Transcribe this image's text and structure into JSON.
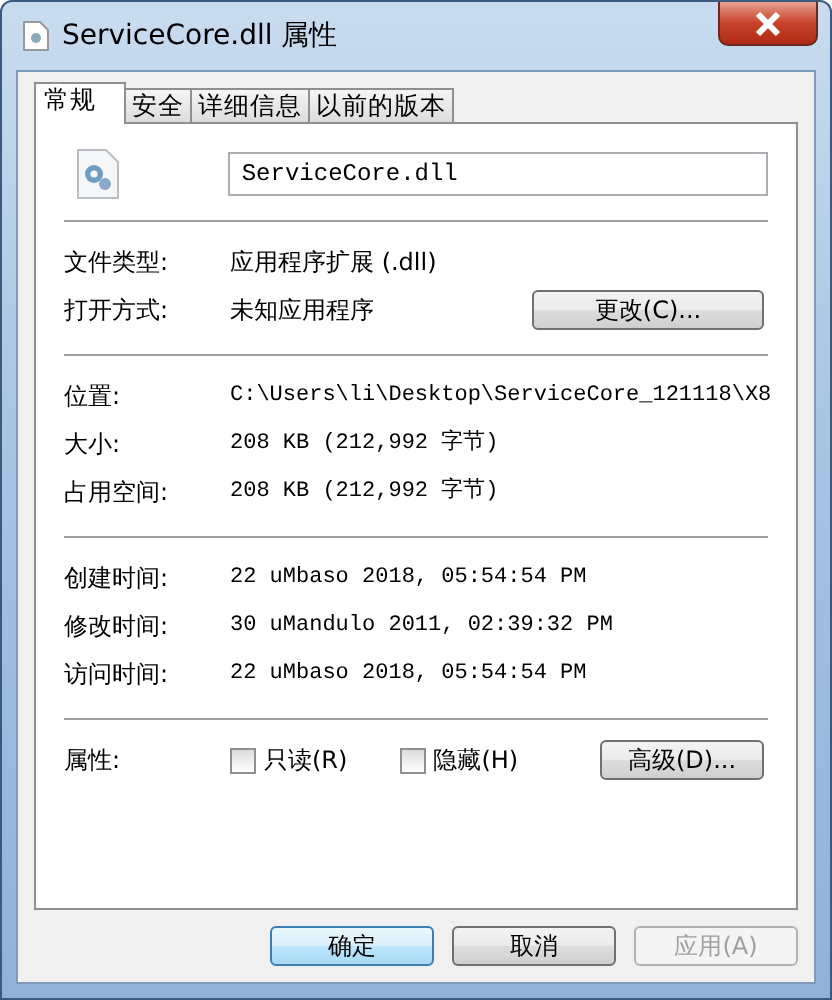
{
  "window": {
    "title": "ServiceCore.dll 属性"
  },
  "tabs": [
    {
      "label": "常规",
      "selected": true
    },
    {
      "label": "安全",
      "selected": false
    },
    {
      "label": "详细信息",
      "selected": false
    },
    {
      "label": "以前的版本",
      "selected": false
    }
  ],
  "file_name": "ServiceCore.dll",
  "type_rows": [
    {
      "label": "文件类型:",
      "value": "应用程序扩展 (.dll)"
    },
    {
      "label": "打开方式:",
      "value": "未知应用程序",
      "button": "更改(C)..."
    }
  ],
  "location_rows": [
    {
      "label": "位置:",
      "value": "C:\\Users\\li\\Desktop\\ServiceCore_121118\\X8"
    },
    {
      "label": "大小:",
      "value": "208 KB (212,992 字节)"
    },
    {
      "label": "占用空间:",
      "value": "208 KB (212,992 字节)"
    }
  ],
  "time_rows": [
    {
      "label": "创建时间:",
      "value": "22 uMbaso 2018, 05:54:54 PM"
    },
    {
      "label": "修改时间:",
      "value": "30 uMandulo 2011, 02:39:32 PM"
    },
    {
      "label": "访问时间:",
      "value": "22 uMbaso 2018, 05:54:54 PM"
    }
  ],
  "attributes": {
    "label": "属性:",
    "checkboxes": [
      {
        "label": "只读(R)",
        "checked": false
      },
      {
        "label": "隐藏(H)",
        "checked": false
      }
    ],
    "button": "高级(D)..."
  },
  "buttons": [
    {
      "label": "确定",
      "default": true,
      "disabled": false
    },
    {
      "label": "取消",
      "default": false,
      "disabled": false
    },
    {
      "label": "应用(A)",
      "default": false,
      "disabled": true
    }
  ]
}
